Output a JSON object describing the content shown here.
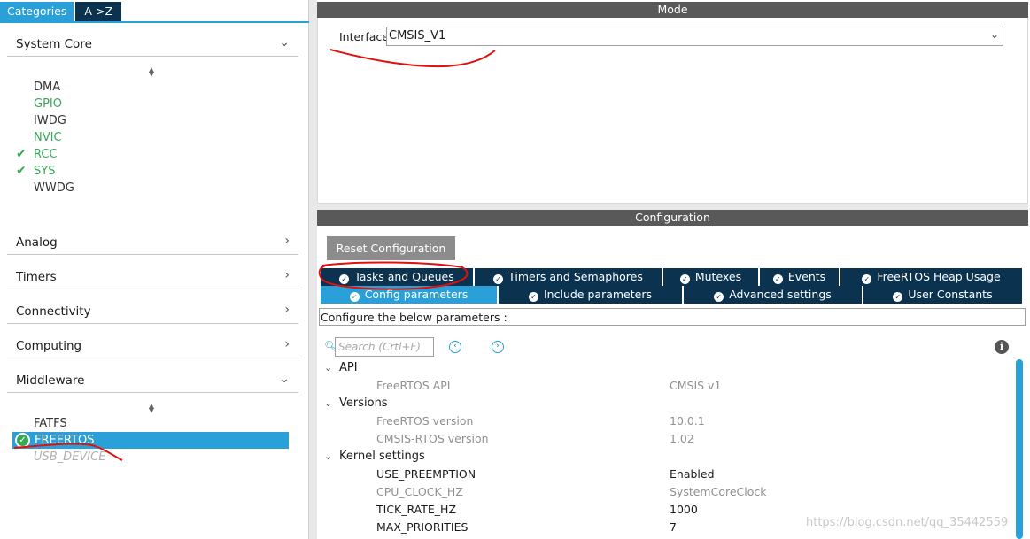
{
  "view_tabs": {
    "categories": "Categories",
    "az": "A->Z"
  },
  "left": {
    "system_core": "System Core",
    "system_core_items": [
      "DMA",
      "GPIO",
      "IWDG",
      "NVIC",
      "RCC",
      "SYS",
      "WWDG"
    ],
    "analog": "Analog",
    "timers": "Timers",
    "connectivity": "Connectivity",
    "computing": "Computing",
    "middleware": "Middleware",
    "middleware_items": [
      "FATFS",
      "FREERTOS",
      "USB_DEVICE"
    ]
  },
  "mode": {
    "header": "Mode",
    "interface_label": "Interface",
    "interface_value": "CMSIS_V1"
  },
  "config": {
    "header": "Configuration",
    "reset_button": "Reset Configuration",
    "tabs_row1": [
      "Tasks and Queues",
      "Timers and Semaphores",
      "Mutexes",
      "Events",
      "FreeRTOS Heap Usage"
    ],
    "tabs_row2": [
      "Config parameters",
      "Include parameters",
      "Advanced settings",
      "User Constants"
    ],
    "description": "Configure the below parameters :",
    "search_placeholder": "Search (Crtl+F)"
  },
  "params": {
    "api": {
      "group": "API",
      "rows": [
        {
          "name": "FreeRTOS API",
          "value": "CMSIS v1"
        }
      ]
    },
    "versions": {
      "group": "Versions",
      "rows": [
        {
          "name": "FreeRTOS version",
          "value": "10.0.1"
        },
        {
          "name": "CMSIS-RTOS version",
          "value": "1.02"
        }
      ]
    },
    "kernel": {
      "group": "Kernel settings",
      "rows": [
        {
          "name": "USE_PREEMPTION",
          "value": "Enabled"
        },
        {
          "name": "CPU_CLOCK_HZ",
          "value": "SystemCoreClock"
        },
        {
          "name": "TICK_RATE_HZ",
          "value": "1000"
        },
        {
          "name": "MAX_PRIORITIES",
          "value": "7"
        }
      ]
    }
  },
  "watermark": "https://blog.csdn.net/qq_35442559",
  "colors": {
    "accent": "#2aa0d8",
    "navy": "#0b3350",
    "enabled_green": "#3aa757",
    "annotation_red": "#e01010"
  }
}
